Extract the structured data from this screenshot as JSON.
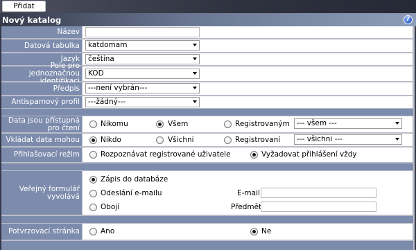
{
  "toolbar": {
    "add_label": "Přidat"
  },
  "header": {
    "title": "Nový katalog",
    "help_icon": "help-icon",
    "help_glyph": "?"
  },
  "fields": {
    "nazev": {
      "label": "Název",
      "value": ""
    },
    "datova_tabulka": {
      "label": "Datová tabulka",
      "value": "katdomam"
    },
    "jazyk": {
      "label": "Jazyk",
      "value": "čeština"
    },
    "pole_id": {
      "label": "Pole pro jednoznačnou identifikaci",
      "value": "KOD"
    },
    "predpis": {
      "label": "Předpis",
      "value": "---není vybrán---"
    },
    "antispam": {
      "label": "Antispamový profil",
      "value": "---žádný---"
    }
  },
  "access": {
    "read": {
      "label": "Data jsou přístupná pro čtení",
      "options": [
        "Nikomu",
        "Všem",
        "Registrovaným"
      ],
      "selected": "Všem",
      "group_value": "--- všem ---"
    },
    "insert": {
      "label": "Vkládat data mohou",
      "options": [
        "Nikdo",
        "Všichni",
        "Registrovaní"
      ],
      "selected": "Nikdo",
      "group_value": "--- všichni ---"
    },
    "login": {
      "label": "Přihlašovací režim",
      "options": [
        "Rozpoznávat registrované uživatele",
        "Vyžadovat přihlášení vždy"
      ],
      "selected": "Vyžadovat přihlášení vždy"
    }
  },
  "public_form": {
    "label": "Veřejný formulář vyvolává",
    "options": [
      "Zápis do databáze",
      "Odeslání e-mailu",
      "Obojí"
    ],
    "selected": "Zápis do databáze",
    "email_label": "E-mail",
    "email_value": "",
    "subject_label": "Předmět",
    "subject_value": ""
  },
  "confirm": {
    "label": "Potvrzovací stránka",
    "options": [
      "Ano",
      "Ne"
    ],
    "selected": "Ne"
  },
  "colors": {
    "label_bg": "#7d8cad",
    "frame_bg": "#bbbcc9",
    "title_gradient_end": "#8c9cb8"
  }
}
